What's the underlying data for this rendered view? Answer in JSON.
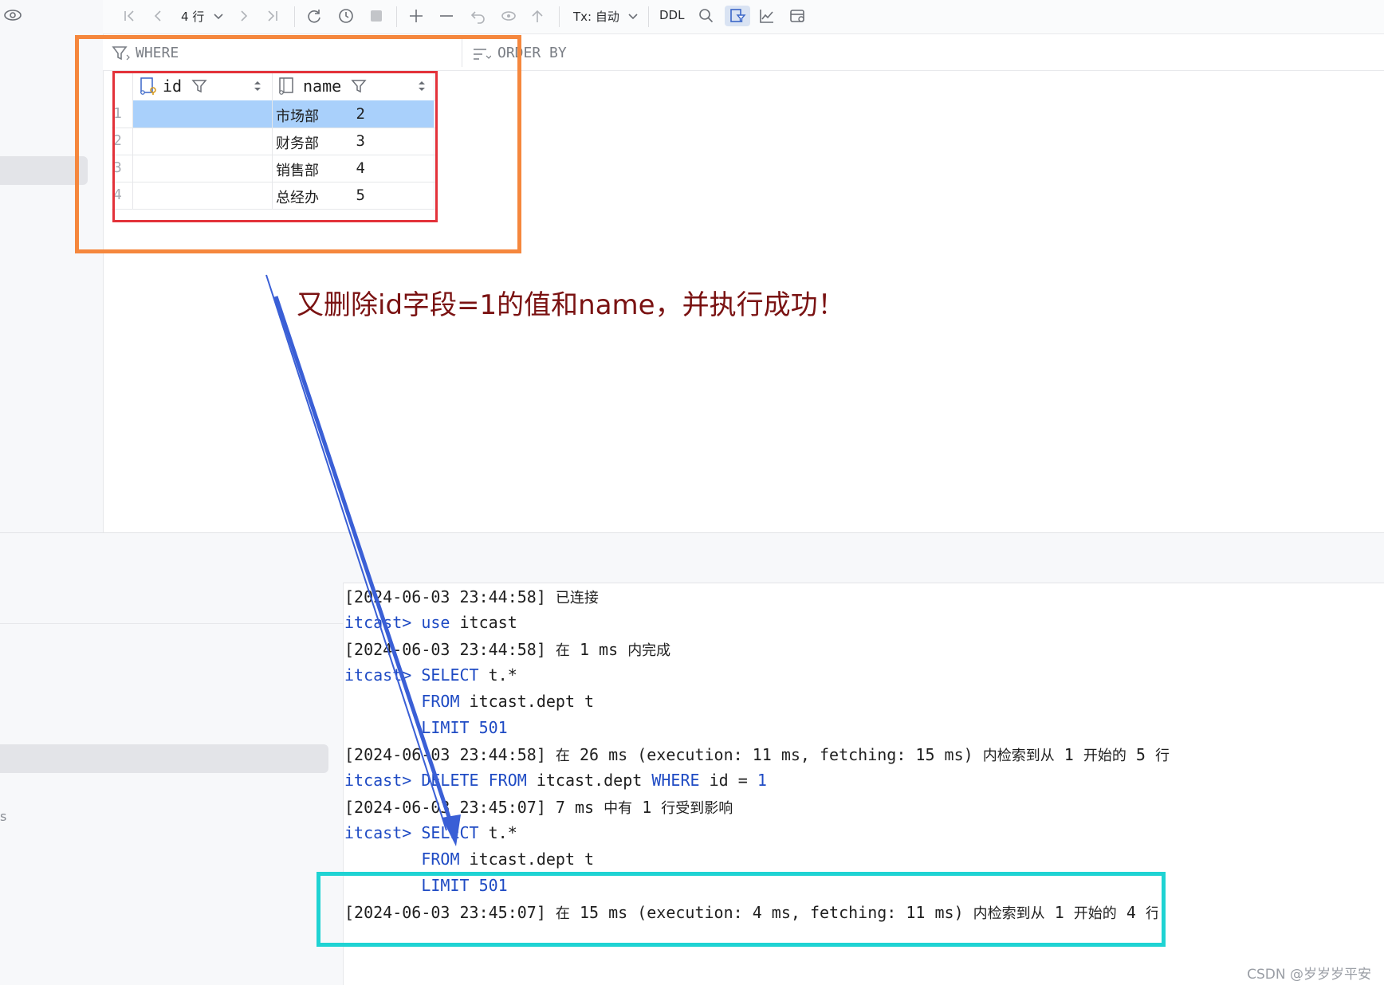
{
  "toolbar": {
    "row_count": "4 行",
    "tx_mode": "Tx: 自动",
    "ddl_label": "DDL"
  },
  "filter_bar": {
    "where_label": "WHERE",
    "order_by_label": "ORDER BY"
  },
  "table": {
    "columns": [
      "id",
      "name"
    ],
    "rows": [
      {
        "num": "1",
        "id": "2",
        "name": "市场部"
      },
      {
        "num": "2",
        "id": "3",
        "name": "财务部"
      },
      {
        "num": "3",
        "id": "4",
        "name": "销售部"
      },
      {
        "num": "4",
        "id": "5",
        "name": "总经办"
      }
    ],
    "selected_row": 0
  },
  "annotation": "又删除id字段=1的值和name，并执行成功！",
  "console": {
    "l1_ts": "[2024-06-03 23:44:58]",
    "l1_msg": "已连接",
    "l2_prompt": "itcast>",
    "l2_kw": "use",
    "l2_rest": "itcast",
    "l3_ts": "[2024-06-03 23:44:58]",
    "l3_a": "在",
    "l3_b": "1 ms",
    "l3_c": "内完成",
    "l4_prompt": "itcast>",
    "l4_kw": "SELECT",
    "l4_rest": "t.*",
    "l5_kw": "FROM",
    "l5_rest": "itcast.dept t",
    "l6_kw": "LIMIT",
    "l6_num": "501",
    "l7_ts": "[2024-06-03 23:44:58]",
    "l7_a": "在",
    "l7_b": "26 ms (execution: 11 ms, fetching: 15 ms)",
    "l7_c": "内检索到从",
    "l7_d": "1",
    "l7_e": "开始的",
    "l7_f": "5",
    "l7_g": "行",
    "l8_prompt": "itcast>",
    "l8_kw1": "DELETE FROM",
    "l8_rest": "itcast.dept",
    "l8_kw2": "WHERE",
    "l8_rest2": "id =",
    "l8_num": "1",
    "l9_ts": "[2024-06-03 23:45:07]",
    "l9_a": "7 ms",
    "l9_b": "中有",
    "l9_c": "1",
    "l9_d": "行受到影响",
    "l10_prompt": "itcast>",
    "l10_kw": "SELECT",
    "l10_rest": "t.*",
    "l11_kw": "FROM",
    "l11_rest": "itcast.dept t",
    "l12_kw": "LIMIT",
    "l12_num": "501",
    "l13_ts": "[2024-06-03 23:45:07]",
    "l13_a": "在",
    "l13_b": "15 ms (execution: 4 ms, fetching: 11 ms)",
    "l13_c": "内检索到从",
    "l13_d": "1",
    "l13_e": "开始的",
    "l13_f": "4",
    "l13_g": "行"
  },
  "left_panel_fragment": "s",
  "watermark": "CSDN @岁岁岁平安",
  "colors": {
    "annotation_orange": "#f5873d",
    "annotation_red": "#e3323a",
    "annotation_cyan": "#1fd3d3",
    "arrow_blue": "#3a5fd6",
    "selected_row": "#a9d0fb",
    "keyword_blue": "#1f4bc4",
    "annotation_text": "#7a1212"
  }
}
